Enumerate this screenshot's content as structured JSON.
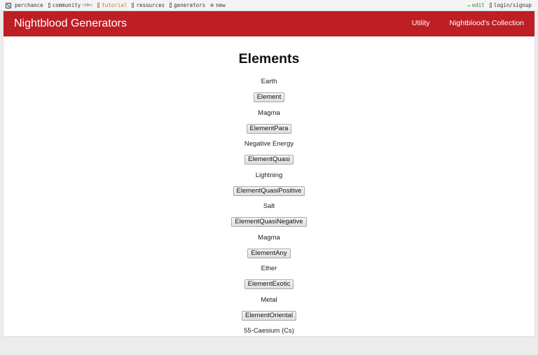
{
  "topbar": {
    "site": "perchance",
    "community": "community",
    "community_badge": "(10h)",
    "tutorial": "tutorial",
    "resources": "resources",
    "generators": "generators",
    "new": "new",
    "edit": "edit",
    "login": "login/signup"
  },
  "header": {
    "brand": "Nightblood Generators",
    "nav": [
      "Utility",
      "Nightblood's Collection"
    ]
  },
  "main": {
    "title": "Elements",
    "rows": [
      {
        "value": "Earth",
        "button": "Element"
      },
      {
        "value": "Magma",
        "button": "ElementPara"
      },
      {
        "value": "Negative Energy",
        "button": "ElementQuasi"
      },
      {
        "value": "Lightning",
        "button": "ElementQuasiPositive"
      },
      {
        "value": "Salt",
        "button": "ElementQuasiNegative"
      },
      {
        "value": "Magma",
        "button": "ElementAny"
      },
      {
        "value": "Ether",
        "button": "ElementExotic"
      },
      {
        "value": "Metal",
        "button": "ElementOriental"
      },
      {
        "value": "55-Caesium (Cs)",
        "button": ""
      }
    ]
  },
  "colors": {
    "navbar": "#bd1f24",
    "tutorial": "#d07a1a",
    "edit": "#2f8a2f"
  }
}
